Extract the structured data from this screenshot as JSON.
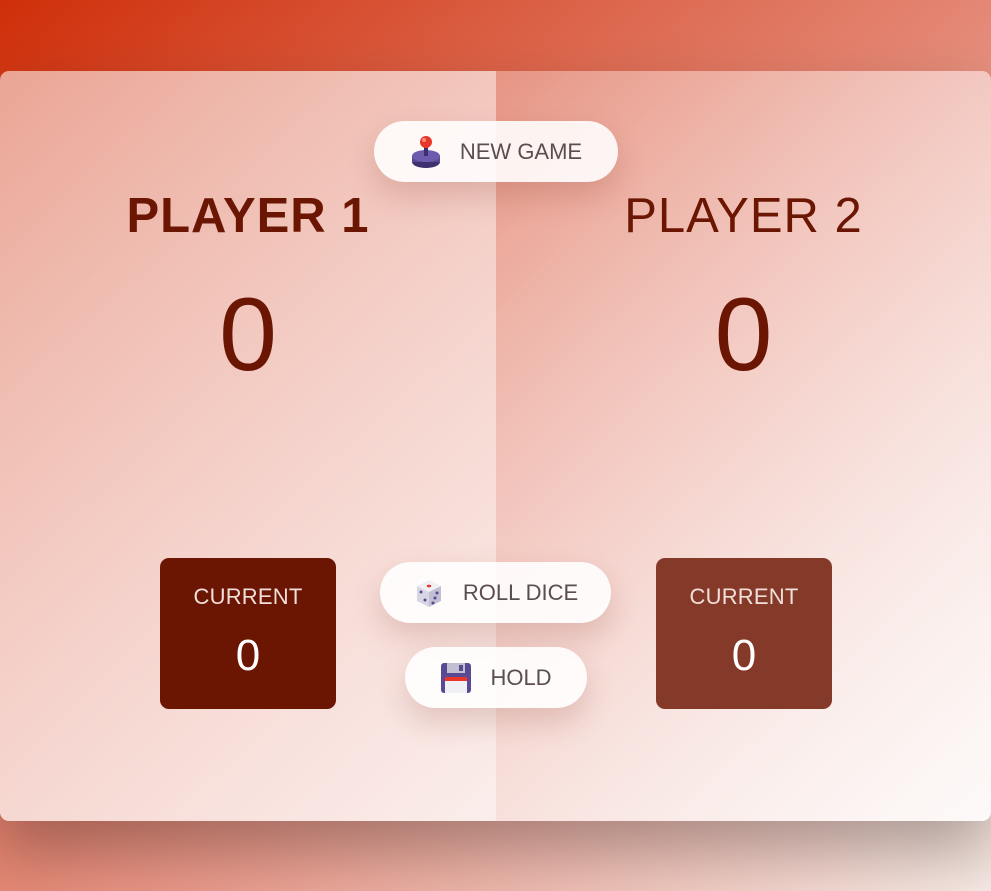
{
  "players": [
    {
      "name": "PLAYER 1",
      "score": "0",
      "current_label": "CURRENT",
      "current_score": "0",
      "active": true
    },
    {
      "name": "PLAYER 2",
      "score": "0",
      "current_label": "CURRENT",
      "current_score": "0",
      "active": false
    }
  ],
  "buttons": {
    "new_game": {
      "label": "NEW GAME",
      "icon": "joystick-icon"
    },
    "roll_dice": {
      "label": "ROLL DICE",
      "icon": "dice-icon"
    },
    "hold": {
      "label": "HOLD",
      "icon": "floppy-disk-icon"
    }
  },
  "colors": {
    "text_dark_red": "#6b1503",
    "current_active": "#6b1503",
    "current_inactive": "#853a29",
    "button_text": "#5b4e4e"
  }
}
